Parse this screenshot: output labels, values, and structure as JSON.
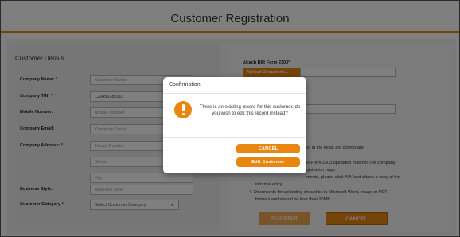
{
  "header": {
    "title": "Customer Registration"
  },
  "form": {
    "section_title": "Customer Details",
    "company_name": {
      "label": "Company Name:",
      "req": "*",
      "placeholder": "Customer Name"
    },
    "company_tin": {
      "label": "Company TIN:",
      "req": "*",
      "value": "123456789101"
    },
    "mobile_number": {
      "label": "Mobile Number:",
      "placeholder": "Mobile Number"
    },
    "company_email": {
      "label": "Company Email:",
      "placeholder": "Company Email"
    },
    "company_address": {
      "label": "Company Address:",
      "req": "*",
      "placeholder_house": "House Number",
      "placeholder_street": "Street",
      "placeholder_city": "City"
    },
    "business_style": {
      "label": "Business Style:",
      "placeholder": "Business Style"
    },
    "customer_category": {
      "label": "Customer Category",
      "req": "*",
      "value": "Select Customer Category"
    }
  },
  "right": {
    "attach_label": "Attach BIR Form 2303",
    "attach_req": "*",
    "upload_label": "Upload Document...",
    "notes": {
      "line1": "rmation typed in the fields are correct and",
      "line2": "R Form 2303 uploaded matches the company",
      "line3": "gistration page.",
      "line4": "ments, please click 'NA' and attach a copy of the",
      "line5": "informal entry",
      "line6": "4. Documents for uploading should be in Microsoft Word, image or PDF",
      "line7": "formats and should be less than 20MB."
    },
    "register_label": "REGISTER",
    "cancel_label": "CANCEL"
  },
  "modal": {
    "title": "Confirmation",
    "message": "There is an existing record for this customer, do you wish to edit this record instead?",
    "cancel_label": "CANCEL",
    "edit_label": "Edit Customer"
  }
}
